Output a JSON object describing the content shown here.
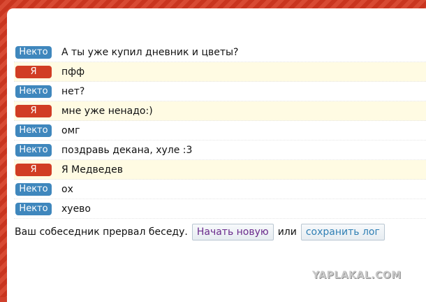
{
  "colors": {
    "stranger_badge": "#3f87bd",
    "me_badge": "#d13d24",
    "me_row_bg": "#fffbe3",
    "frame": "#d0402c"
  },
  "messages": [
    {
      "author": "Некто",
      "role": "stranger",
      "text": "А ты уже купил дневник и цветы?"
    },
    {
      "author": "Я",
      "role": "me",
      "text": "пфф"
    },
    {
      "author": "Некто",
      "role": "stranger",
      "text": "нет?"
    },
    {
      "author": "Я",
      "role": "me",
      "text": "мне уже ненадо:)"
    },
    {
      "author": "Некто",
      "role": "stranger",
      "text": "омг"
    },
    {
      "author": "Некто",
      "role": "stranger",
      "text": "поздравь декана, хуле :3"
    },
    {
      "author": "Я",
      "role": "me",
      "text": "Я Медведев"
    },
    {
      "author": "Некто",
      "role": "stranger",
      "text": "ох"
    },
    {
      "author": "Некто",
      "role": "stranger",
      "text": "хуево"
    }
  ],
  "status": {
    "text": "Ваш собеседник прервал беседу.",
    "new_chat_label": "Начать новую",
    "or_label": "или",
    "save_log_label": "сохранить лог"
  },
  "watermark": "YAPLAKAL.COM"
}
